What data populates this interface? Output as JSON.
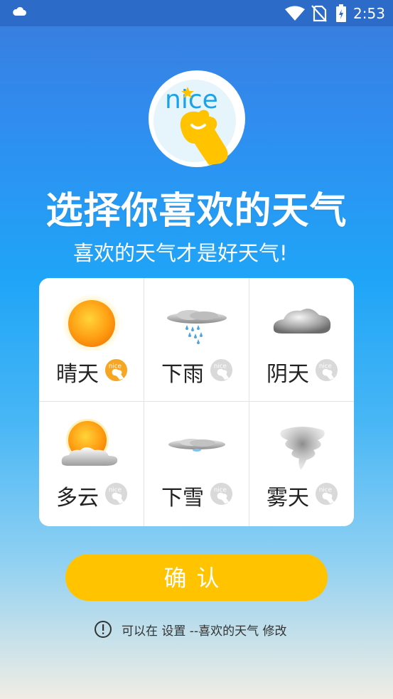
{
  "status_bar": {
    "time": "2:53",
    "icons": [
      "cloud-icon",
      "wifi-icon",
      "no-sim-icon",
      "battery-charging-icon"
    ]
  },
  "brand": {
    "logo_text": "nice"
  },
  "heading": {
    "title": "选择你喜欢的天气",
    "subtitle": "喜欢的天气才是好天气!"
  },
  "weather_options": [
    {
      "label": "晴天",
      "icon": "sunny-icon",
      "selected": true
    },
    {
      "label": "下雨",
      "icon": "rain-icon",
      "selected": false
    },
    {
      "label": "阴天",
      "icon": "overcast-icon",
      "selected": false
    },
    {
      "label": "多云",
      "icon": "cloudy-icon",
      "selected": false
    },
    {
      "label": "下雪",
      "icon": "snow-icon",
      "selected": false
    },
    {
      "label": "雾天",
      "icon": "fog-icon",
      "selected": false
    }
  ],
  "actions": {
    "confirm_label": "确认"
  },
  "hint": {
    "text": "可以在 设置 --喜欢的天气 修改",
    "icon": "info-icon"
  },
  "colors": {
    "accent": "#ffc300",
    "selected_badge": "#f6a623",
    "unselected_badge": "#d9d9d9",
    "status_bar": "#2c6bc8"
  }
}
